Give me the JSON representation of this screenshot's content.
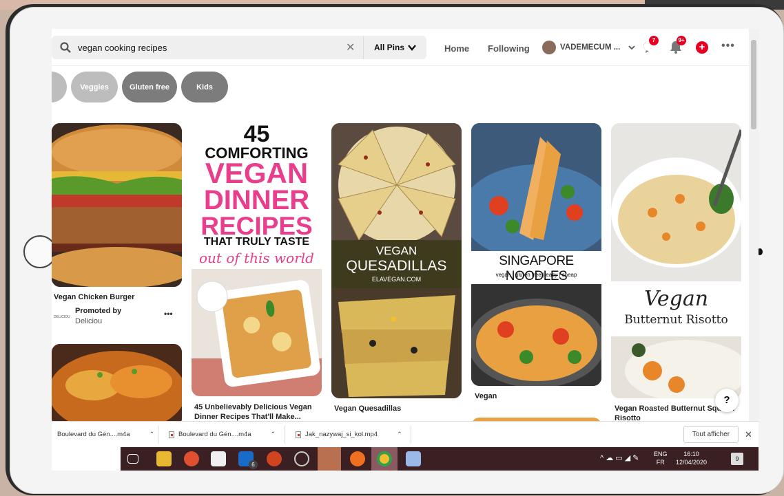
{
  "search": {
    "query": "vegan cooking recipes",
    "scope": "All Pins"
  },
  "nav": {
    "home": "Home",
    "following": "Following",
    "user": "VADEMECUM ...",
    "messages_badge": "7",
    "notifications_badge": "9+"
  },
  "chips": [
    "Veggies",
    "Gluten free",
    "Kids"
  ],
  "pins": [
    {
      "title": "Vegan Chicken Burger",
      "promoted_label": "Promoted by",
      "promoter": "Deliciou",
      "logo_text": "DELICIOU"
    },
    {
      "title": "45 Unbelievably Delicious Vegan Dinner Recipes That'll Make...",
      "overlay": [
        "45",
        "COMFORTING",
        "VEGAN",
        "DINNER",
        "RECIPES",
        "THAT TRULY TASTE",
        "out of this world"
      ]
    },
    {
      "title": "Vegan Quesadillas",
      "overlay": [
        "VEGAN",
        "QUESADILLAS",
        "ELAVEGAN.COM"
      ]
    },
    {
      "title": "Vegan",
      "overlay": [
        "SINGAPORE NOODLES",
        "vegan | gluten free | easy | cheap"
      ]
    },
    {
      "title": "Vegan Roasted Butternut Squash Risotto",
      "overlay": [
        "Vegan",
        "Butternut Risotto"
      ]
    }
  ],
  "downloads": {
    "items": [
      "Boulevard du Gén....m4a",
      "Boulevard du Gén....m4a",
      "Jak_nazywaj_si_kol.mp4"
    ],
    "show_all": "Tout afficher"
  },
  "taskbar": {
    "lang1": "ENG",
    "lang2": "FR",
    "time": "16:10",
    "date": "12/04/2020",
    "mail_badge": "6",
    "notif_count": "9"
  },
  "help": "?"
}
